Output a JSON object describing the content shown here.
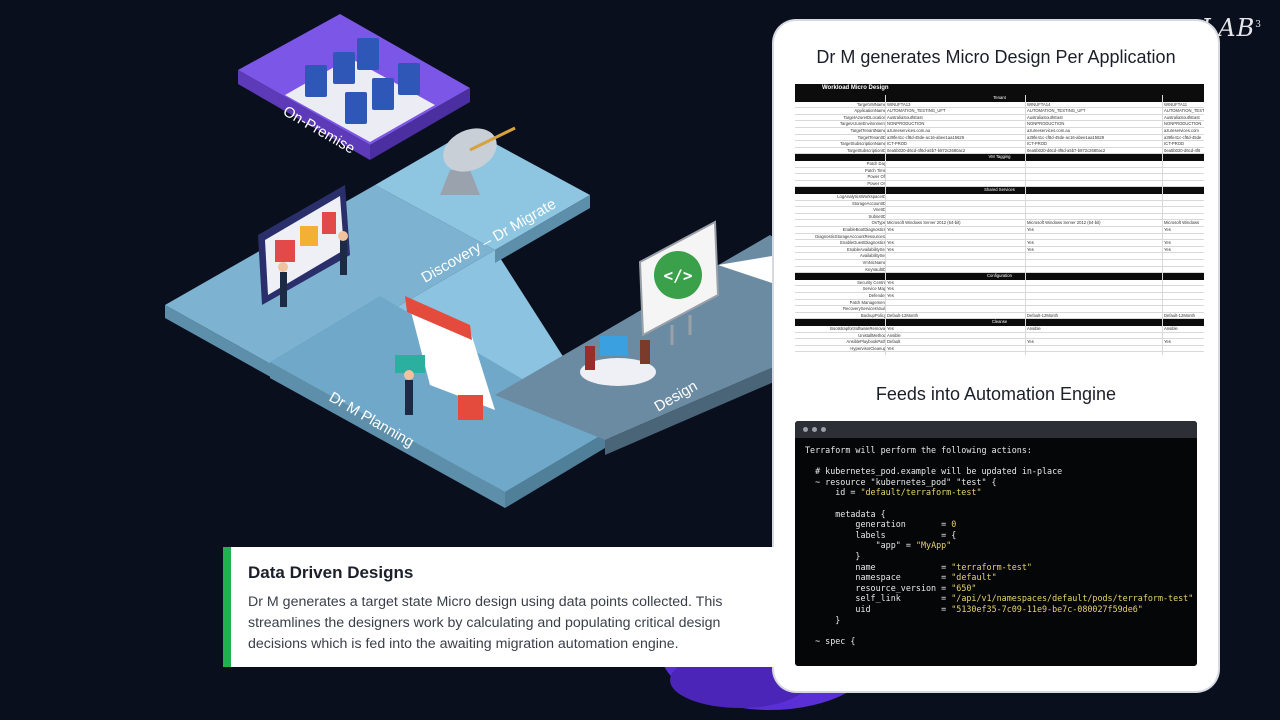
{
  "logo": {
    "text": "LAB",
    "sup": "3"
  },
  "scene": {
    "zones": [
      {
        "name": "On-Premise"
      },
      {
        "name": "Discovery – Dr Migrate"
      },
      {
        "name": "Dr M Planning"
      },
      {
        "name": "Design"
      }
    ],
    "design_board_icon": "</>"
  },
  "card": {
    "title": "Dr M generates Micro Design Per Application",
    "subtitle": "Feeds into Automation Engine",
    "sheet": {
      "title": "Workload Micro Design",
      "rows": [
        {
          "section": "Tenant"
        },
        {
          "k": "TargetVMName",
          "c1": "WINUFTA13",
          "c2": "WINUFTA14",
          "c3": "WINUFTA11"
        },
        {
          "k": "ApplicationName",
          "c1": "AUTOMATION_TESTING_UFT",
          "c2": "AUTOMATION_TESTING_UFT",
          "c3": "AUTOMATION_TESTI"
        },
        {
          "k": "TargetAzureIDLocation",
          "c1": "AustraliaSouthEast",
          "c2": "AustraliaSouthEast",
          "c3": "AustraliaSouthEast"
        },
        {
          "k": "TargetAzureEnvironment",
          "c1": "NONPRODUCTION",
          "c2": "NONPRODUCTION",
          "c3": "NONPRODUCTION"
        },
        {
          "k": "TargetTenantName",
          "c1": "azureeservices.com.au",
          "c2": "azureeservices.com.au",
          "c3": "azureservices.com"
        },
        {
          "k": "TargetTenantID",
          "c1": "a39fe41c-cf8d-45de-ac16-abee1aa15629",
          "c2": "a39fe41c-cf8d-45de-ac16-abee1aa15629",
          "c3": "a39fe41c-cf8d-45de"
        },
        {
          "k": "TargetSubscriptionName",
          "c1": "ICT-PROD",
          "c2": "ICT-PROD",
          "c3": "ICT-PROD"
        },
        {
          "k": "TargetSubscriptionID",
          "c1": "0ea5b020-d6cd-4f6d-a5b7-b872c2680ac2",
          "c2": "0ea5b020-d6cd-4f6d-a5b7-b872c2680ac2",
          "c3": "0ea5b020-d6cd-4f6"
        },
        {
          "section": "VM Tagging"
        },
        {
          "k": "Patch Day"
        },
        {
          "k": "Patch Time"
        },
        {
          "k": "Power Off"
        },
        {
          "k": "Power On"
        },
        {
          "section": "Shared Services"
        },
        {
          "k": "LogAnalyticsWorkspaceID"
        },
        {
          "k": "StorageAccountID"
        },
        {
          "k": "VnetID"
        },
        {
          "k": "SubnetID"
        },
        {
          "k": "OsType",
          "c1": "Microsoft Windows Server 2012 (64-bit)",
          "c2": "Microsoft Windows Server 2012 (64-bit)",
          "c3": "Microsoft Windows"
        },
        {
          "k": "EnableBootDiagnostics",
          "c1": "Yes",
          "c2": "Yes",
          "c3": "Yes"
        },
        {
          "k": "DiagnosticStorageAccountResourceId"
        },
        {
          "k": "EnableGuestDiagnostics",
          "c1": "Yes",
          "c2": "Yes",
          "c3": "Yes"
        },
        {
          "k": "EnableAvailabilitySet",
          "c1": "Yes",
          "c2": "Yes",
          "c3": "Yes"
        },
        {
          "k": "AvailabilitySet"
        },
        {
          "k": "VmNicName"
        },
        {
          "k": "KeyVaultID"
        },
        {
          "section": "Configuration"
        },
        {
          "k": "Security Centre",
          "c1": "Yes"
        },
        {
          "k": "Service Map",
          "c1": "Yes"
        },
        {
          "k": "Defender",
          "c1": "Yes"
        },
        {
          "k": "Patch Management"
        },
        {
          "k": "RecoveryServicesVault"
        },
        {
          "k": "BackupPolicy",
          "c1": "Default-12Month",
          "c2": "Default-12Month",
          "c3": "Default-12Month"
        },
        {
          "section": "Cleanse"
        },
        {
          "k": "BootstrapforSoftwareRemoval",
          "c1": "Yes",
          "c2": "Ansible",
          "c3": "Ansible"
        },
        {
          "k": "UnistallMethod",
          "c1": "Ansible"
        },
        {
          "k": "AnsiblePlaybookPath",
          "c1": "Default",
          "c2": "Yes",
          "c3": "Yes"
        },
        {
          "k": "HypervisorCleanup",
          "c1": "Yes"
        }
      ]
    },
    "terminal": {
      "lines": [
        [
          {
            "t": "Terraform will perform the following actions:"
          }
        ],
        [
          {
            "t": ""
          }
        ],
        [
          {
            "t": "  # kubernetes_pod.example will be updated in-place"
          }
        ],
        [
          {
            "t": "  ~ resource \"kubernetes_pod\" \"test\" {"
          }
        ],
        [
          {
            "t": "      id = "
          },
          {
            "t": "\"default/terraform-test\"",
            "s": true
          }
        ],
        [
          {
            "t": ""
          }
        ],
        [
          {
            "t": "      metadata {"
          }
        ],
        [
          {
            "t": "          generation       = "
          },
          {
            "t": "0",
            "s": true
          }
        ],
        [
          {
            "t": "          labels           = {"
          }
        ],
        [
          {
            "t": "              \"app\" = "
          },
          {
            "t": "\"MyApp\"",
            "s": true
          }
        ],
        [
          {
            "t": "          }"
          }
        ],
        [
          {
            "t": "          name             = "
          },
          {
            "t": "\"terraform-test\"",
            "s": true
          }
        ],
        [
          {
            "t": "          namespace        = "
          },
          {
            "t": "\"default\"",
            "s": true
          }
        ],
        [
          {
            "t": "          resource_version = "
          },
          {
            "t": "\"650\"",
            "s": true
          }
        ],
        [
          {
            "t": "          self_link        = "
          },
          {
            "t": "\"/api/v1/namespaces/default/pods/terraform-test\"",
            "s": true
          }
        ],
        [
          {
            "t": "          uid              = "
          },
          {
            "t": "\"5130ef35-7c09-11e9-be7c-080027f59de6\"",
            "s": true
          }
        ],
        [
          {
            "t": "      }"
          }
        ],
        [
          {
            "t": ""
          }
        ],
        [
          {
            "t": "  ~ spec {"
          }
        ]
      ]
    }
  },
  "callout": {
    "title": "Data Driven Designs",
    "body": "Dr M generates a target state Micro design using data points collected. This streamlines the designers work by calculating and populating critical design decisions which is fed into the awaiting migration automation engine."
  },
  "colors": {
    "background": "#0a0f1e",
    "accent_green": "#22b14c",
    "platform_light": "#7fb8d6",
    "platform_purple": "#7a4fe0"
  }
}
